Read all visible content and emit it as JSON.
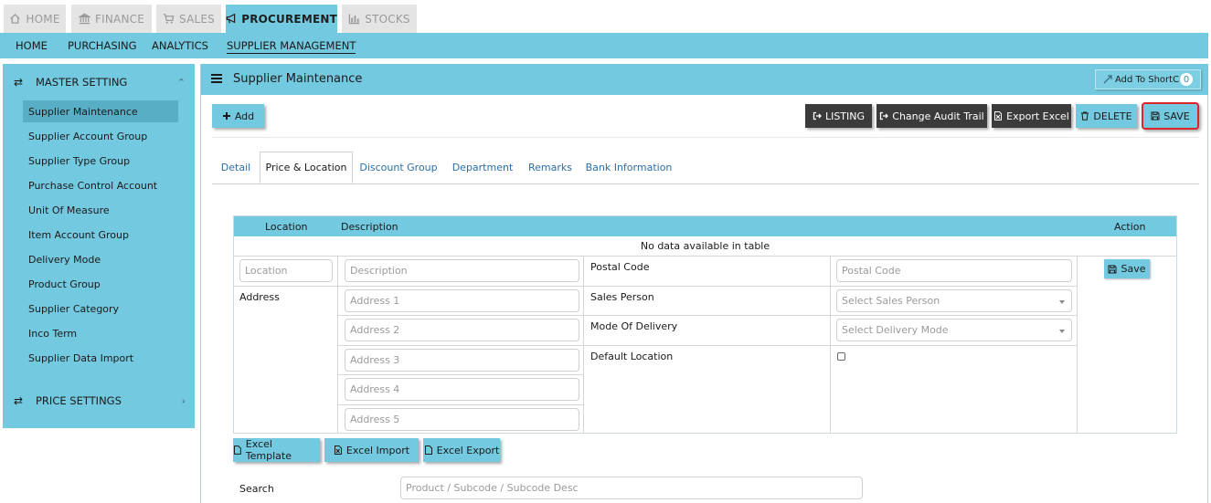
{
  "top_tabs": [
    {
      "label": "HOME",
      "icon": "home-icon"
    },
    {
      "label": "FINANCE",
      "icon": "bank-icon"
    },
    {
      "label": "SALES",
      "icon": "cart-icon"
    },
    {
      "label": "PROCUREMENT",
      "icon": "megaphone-icon",
      "active": true
    },
    {
      "label": "STOCKS",
      "icon": "bar-chart-icon"
    }
  ],
  "sub_nav": [
    "HOME",
    "PURCHASING",
    "ANALYTICS",
    "SUPPLIER MANAGEMENT"
  ],
  "sidebar": {
    "master_title": "MASTER SETTING",
    "items": [
      "Supplier Maintenance",
      "Supplier Account Group",
      "Supplier Type Group",
      "Purchase Control Account",
      "Unit Of Measure",
      "Item Account Group",
      "Delivery Mode",
      "Product Group",
      "Supplier Category",
      "Inco Term",
      "Supplier Data Import"
    ],
    "price_title": "PRICE SETTINGS"
  },
  "panel": {
    "title": "Supplier Maintenance",
    "shortcut_label": "Add To ShortCut",
    "shortcut_count": "0"
  },
  "toolbar": {
    "add": "Add",
    "listing": "LISTING",
    "audit": "Change Audit Trail",
    "export": "Export Excel",
    "delete": "DELETE",
    "save": "SAVE"
  },
  "tabs": [
    "Detail",
    "Price & Location",
    "Discount Group",
    "Department",
    "Remarks",
    "Bank Information"
  ],
  "grid": {
    "headers": {
      "location": "Location",
      "description": "Description",
      "action": "Action"
    },
    "empty_message": "No data available in table",
    "placeholders": {
      "location": "Location",
      "description": "Description",
      "address1": "Address 1",
      "address2": "Address 2",
      "address3": "Address 3",
      "address4": "Address 4",
      "address5": "Address 5",
      "postal": "Postal Code",
      "sales_person": "Select Sales Person",
      "delivery_mode": "Select Delivery Mode"
    },
    "labels": {
      "address": "Address",
      "postal": "Postal Code",
      "sales_person": "Sales Person",
      "delivery_mode": "Mode Of Delivery",
      "default_location": "Default Location"
    },
    "row_save": "Save"
  },
  "excel": {
    "template": "Excel Template",
    "import": "Excel Import",
    "export": "Excel Export"
  },
  "search": {
    "label": "Search",
    "placeholder": "Product / Subcode / Subcode Desc"
  },
  "colors": {
    "accent": "#73c9df",
    "dark_button": "#3b3b3b",
    "highlight": "#d9262b"
  }
}
